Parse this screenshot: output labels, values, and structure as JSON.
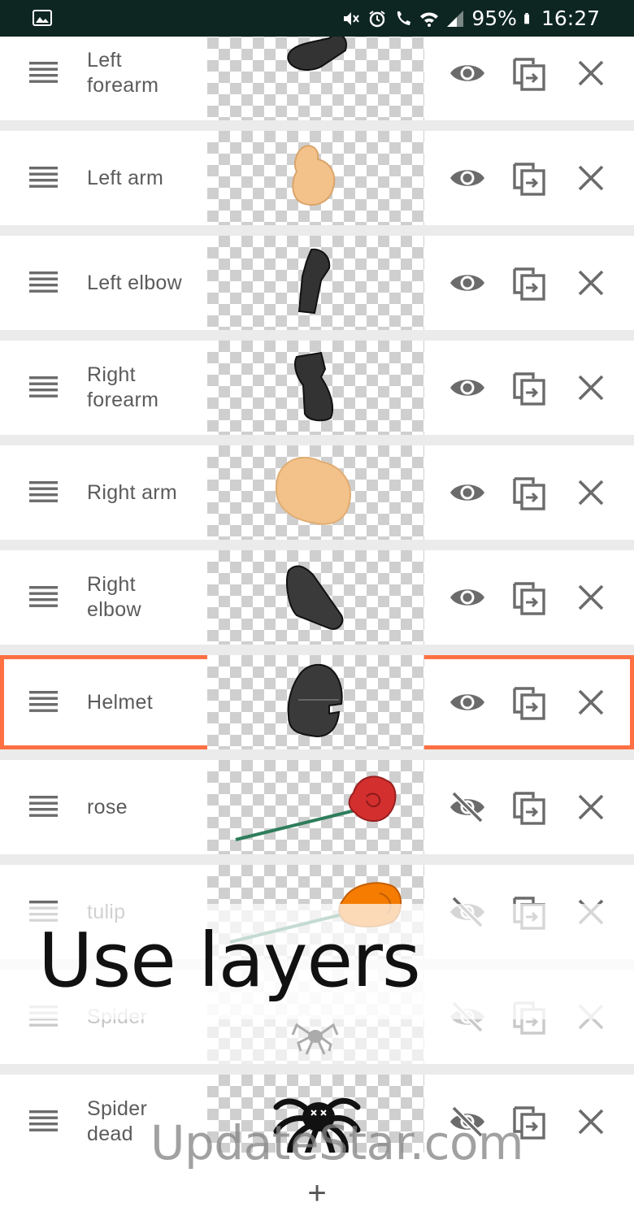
{
  "status_bar": {
    "battery_percent": "95%",
    "time": "16:27"
  },
  "layers": [
    {
      "name": "Left\nforearm",
      "visible": true
    },
    {
      "name": "Left arm",
      "visible": true
    },
    {
      "name": "Left elbow",
      "visible": true
    },
    {
      "name": "Right\nforearm",
      "visible": true
    },
    {
      "name": "Right arm",
      "visible": true
    },
    {
      "name": "Right\nelbow",
      "visible": true
    },
    {
      "name": "Helmet",
      "visible": true,
      "selected": true
    },
    {
      "name": "rose",
      "visible": false
    },
    {
      "name": "tulip",
      "visible": false
    },
    {
      "name": "Spider",
      "visible": false
    },
    {
      "name": "Spider\ndead",
      "visible": false
    }
  ],
  "caption": "Use layers",
  "watermark": "UpdateStar.com",
  "add_button": "+",
  "colors": {
    "selection_outline": "#ff7043",
    "status_bar_bg": "#0d2622",
    "icon_gray": "#6b6b6b"
  }
}
